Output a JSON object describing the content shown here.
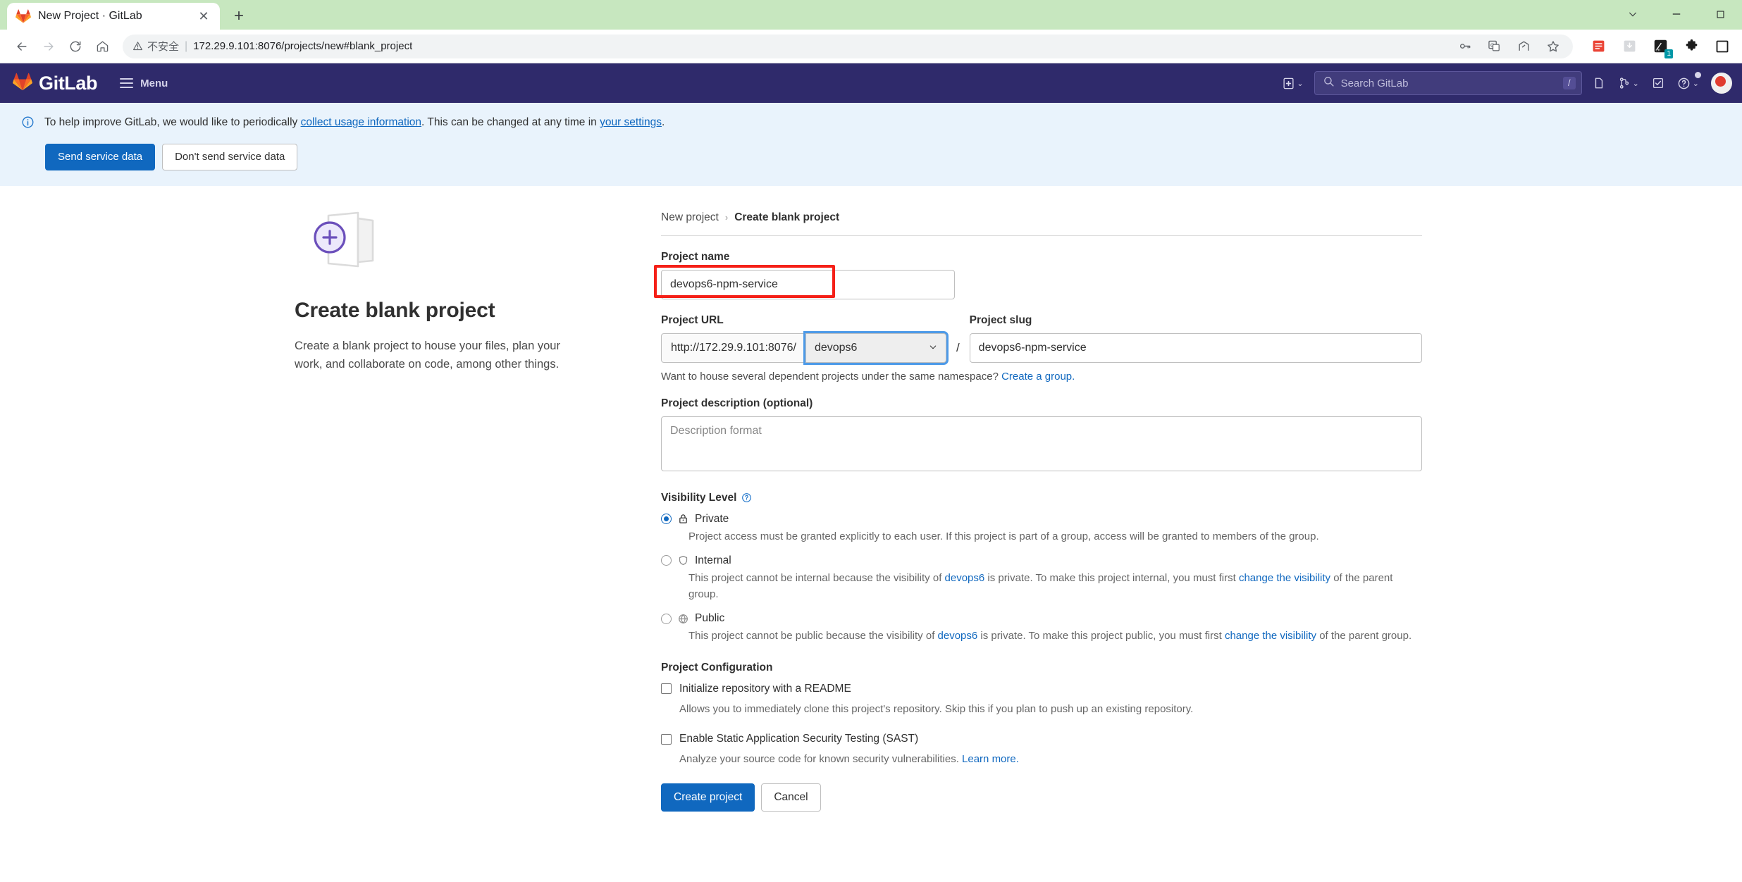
{
  "browser": {
    "tab": {
      "title": "New Project · GitLab",
      "favicon_name": "gitlab-favicon",
      "close_label": "✕"
    },
    "new_tab_label": "+",
    "window": {
      "minimize": "—",
      "maximize": "▢",
      "dropdown": "⌄"
    },
    "omnibox": {
      "warning_label": "不安全",
      "separator": "|",
      "url": "172.29.9.101:8076/projects/new#blank_project"
    },
    "nav": {
      "back": "←",
      "forward": "→",
      "reload": "C",
      "home": "⌂"
    }
  },
  "gitlab_nav": {
    "brand": "GitLab",
    "menu_label": "Menu",
    "search_placeholder": "Search GitLab",
    "search_shortcut": "/"
  },
  "alert": {
    "text_before": "To help improve GitLab, we would like to periodically ",
    "link1": "collect usage information",
    "text_middle": ". This can be changed at any time in ",
    "link2": "your settings",
    "text_after": ".",
    "primary_button": "Send service data",
    "secondary_button": "Don't send service data"
  },
  "left_panel": {
    "title": "Create blank project",
    "description": "Create a blank project to house your files, plan your work, and collaborate on code, among other things."
  },
  "breadcrumb": {
    "parent": "New project",
    "separator": "›",
    "current": "Create blank project"
  },
  "form": {
    "project_name": {
      "label": "Project name",
      "value": "devops6-npm-service"
    },
    "project_url": {
      "label": "Project URL",
      "prefix": "http://172.29.9.101:8076/",
      "namespace": "devops6",
      "slash": "/",
      "hint_text": "Want to house several dependent projects under the same namespace? ",
      "hint_link": "Create a group.",
      "caret": "⌄"
    },
    "project_slug": {
      "label": "Project slug",
      "value": "devops6-npm-service"
    },
    "project_description": {
      "label": "Project description (optional)",
      "placeholder": "Description format",
      "value": ""
    },
    "visibility": {
      "label": "Visibility Level",
      "help_icon": "?",
      "options": [
        {
          "id": "private",
          "title": "Private",
          "icon": "lock-icon",
          "selected": true,
          "description": "Project access must be granted explicitly to each user. If this project is part of a group, access will be granted to members of the group."
        },
        {
          "id": "internal",
          "title": "Internal",
          "icon": "shield-icon",
          "selected": false,
          "desc_part1": "This project cannot be internal because the visibility of ",
          "desc_link1": "devops6",
          "desc_part2": " is private. To make this project internal, you must first ",
          "desc_link2": "change the visibility",
          "desc_part3": " of the parent group."
        },
        {
          "id": "public",
          "title": "Public",
          "icon": "globe-icon",
          "selected": false,
          "desc_part1": "This project cannot be public because the visibility of ",
          "desc_link1": "devops6",
          "desc_part2": " is private. To make this project public, you must first ",
          "desc_link2": "change the visibility",
          "desc_part3": " of the parent group."
        }
      ]
    },
    "configuration": {
      "label": "Project Configuration",
      "items": [
        {
          "id": "readme",
          "label": "Initialize repository with a README",
          "checked": false,
          "description": "Allows you to immediately clone this project's repository. Skip this if you plan to push up an existing repository."
        },
        {
          "id": "sast",
          "label": "Enable Static Application Security Testing (SAST)",
          "checked": false,
          "description": "Analyze your source code for known security vulnerabilities. ",
          "desc_link": "Learn more."
        }
      ]
    },
    "actions": {
      "submit": "Create project",
      "cancel": "Cancel"
    }
  },
  "colors": {
    "gitlab_navy": "#2f2a6b",
    "accent_blue": "#1068bf",
    "annotation_red": "#f52018",
    "tabstrip_green": "#c7e7bf",
    "purple": "#6b4fbb"
  }
}
